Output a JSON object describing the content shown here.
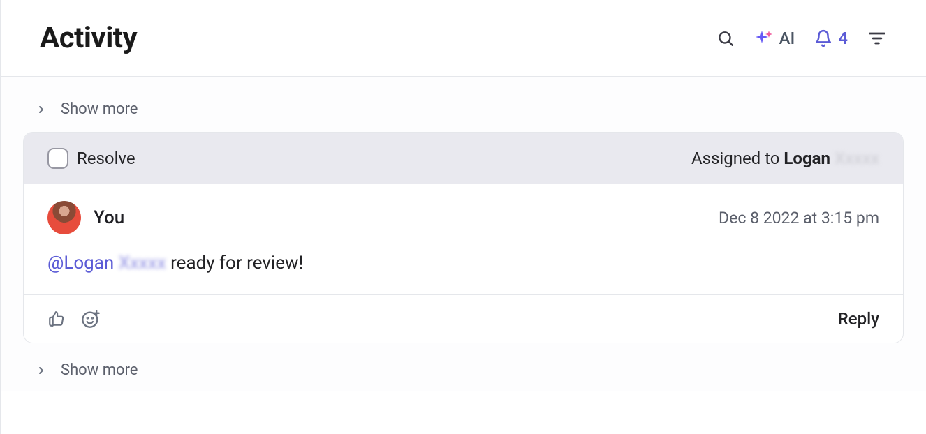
{
  "header": {
    "title": "Activity",
    "ai_label": "AI",
    "notification_count": "4"
  },
  "show_more_top": {
    "label": "Show more"
  },
  "show_more_bottom": {
    "label": "Show more"
  },
  "thread": {
    "resolve_label": "Resolve",
    "assigned_prefix": "Assigned to ",
    "assigned_name": "Logan",
    "assigned_surname": "Xxxxx",
    "author": "You",
    "timestamp": "Dec 8 2022 at 3:15 pm",
    "mention_handle": "@Logan",
    "mention_surname": "Xxxxx",
    "comment_rest": " ready for review!",
    "reply_label": "Reply"
  }
}
